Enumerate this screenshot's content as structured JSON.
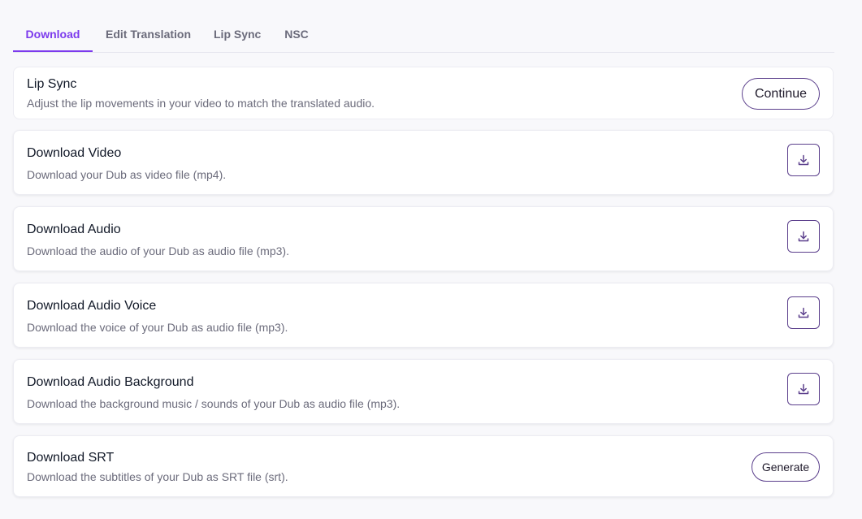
{
  "tabs": [
    {
      "label": "Download",
      "active": true
    },
    {
      "label": "Edit Translation",
      "active": false
    },
    {
      "label": "Lip Sync",
      "active": false
    },
    {
      "label": "NSC",
      "active": false
    }
  ],
  "lip_sync": {
    "title": "Lip Sync",
    "description": "Adjust the lip movements in your video to match the translated audio.",
    "button_label": "Continue"
  },
  "downloads": [
    {
      "title": "Download Video",
      "description": "Download your Dub as video file (mp4).",
      "icon": "download-icon"
    },
    {
      "title": "Download Audio",
      "description": "Download the audio of your Dub as audio file (mp3).",
      "icon": "download-icon"
    },
    {
      "title": "Download Audio Voice",
      "description": "Download the voice of your Dub as audio file (mp3).",
      "icon": "download-icon"
    },
    {
      "title": "Download Audio Background",
      "description": "Download the background music / sounds of your Dub as audio file (mp3).",
      "icon": "download-icon"
    }
  ],
  "srt": {
    "title": "Download SRT",
    "description": "Download the subtitles of your Dub as SRT file (srt).",
    "button_label": "Generate"
  },
  "colors": {
    "accent": "#7c3aed",
    "button_border": "#5b3f8c"
  }
}
